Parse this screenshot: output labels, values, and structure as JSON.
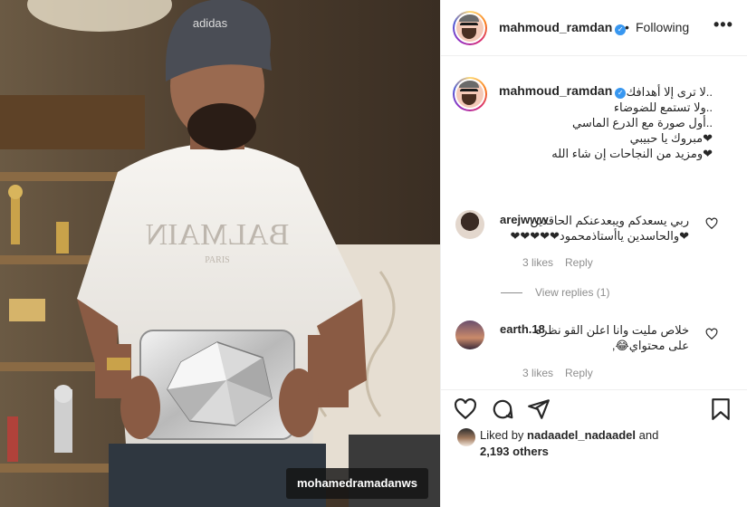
{
  "post": {
    "watermark": "mohamedramadanws"
  },
  "header": {
    "username": "mahmoud_ramdan",
    "separator": "•",
    "follow_label": "Following",
    "more_label": "•••"
  },
  "caption": {
    "username": "mahmoud_ramdan",
    "lines": [
      "..لا ترى إلا أهدافك",
      "..ولا تستمع للضوضاء",
      "..أول صورة مع الدرع الماسي",
      "❤مبروك يا حبيبي",
      "❤ومزيد من النجاحات إن شاء الله"
    ]
  },
  "comments": [
    {
      "username": "arejwww",
      "text_line1": "ربي يسعدكم ويبعدعنكم الحاقدين",
      "text_line2": "❤والحاسدين ياأستاذمحمود❤❤❤❤❤",
      "likes": "3 likes",
      "reply_label": "Reply",
      "view_replies": "View replies (1)"
    },
    {
      "username": "earth.18",
      "text_line1": "خلاص مليت وانا اعلن القو نظره",
      "text_line2": "على محتواي😂,",
      "likes": "3 likes",
      "reply_label": "Reply"
    }
  ],
  "liked_by": {
    "prefix": "Liked by",
    "user": "nadaadel_nadaadel",
    "conjunction": "and",
    "others": "2,193 others"
  },
  "icons": [
    "heart-icon",
    "comment-icon",
    "share-icon",
    "bookmark-icon",
    "more-icon",
    "verified-badge-icon"
  ],
  "colors": {
    "verified": "#3897f0",
    "muted": "#8e8e8e",
    "border": "#efefef",
    "text": "#262626"
  }
}
